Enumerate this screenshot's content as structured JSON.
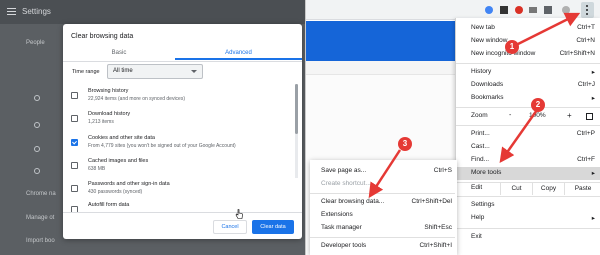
{
  "settings": {
    "title": "Settings",
    "sidebar": [
      "People",
      "Chrome na",
      "Manage ot",
      "Import boo"
    ]
  },
  "dialog": {
    "title": "Clear browsing data",
    "tabs": {
      "basic": "Basic",
      "advanced": "Advanced"
    },
    "time_range_label": "Time range",
    "time_range_value": "All time",
    "items": [
      {
        "title": "Browsing history",
        "sub": "22,924 items (and more on synced devices)",
        "checked": false
      },
      {
        "title": "Download history",
        "sub": "1,213 items",
        "checked": false
      },
      {
        "title": "Cookies and other site data",
        "sub": "From 4,779 sites (you won't be signed out of your Google Account)",
        "checked": true
      },
      {
        "title": "Cached images and files",
        "sub": "638 MB",
        "checked": false
      },
      {
        "title": "Passwords and other sign-in data",
        "sub": "430 passwords (synced)",
        "checked": false
      },
      {
        "title": "Autofill form data",
        "sub": "",
        "checked": false
      }
    ],
    "cancel_label": "Cancel",
    "clear_label": "Clear data",
    "accent": "#1a73e8"
  },
  "menu": {
    "new_tab": {
      "label": "New tab",
      "shortcut": "Ctrl+T"
    },
    "new_window": {
      "label": "New window",
      "shortcut": "Ctrl+N"
    },
    "new_incognito": {
      "label": "New incognito window",
      "shortcut": "Ctrl+Shift+N"
    },
    "history": {
      "label": "History",
      "shortcut": ""
    },
    "downloads": {
      "label": "Downloads",
      "shortcut": "Ctrl+J"
    },
    "bookmarks": {
      "label": "Bookmarks",
      "shortcut": ""
    },
    "zoom": {
      "label": "Zoom",
      "minus": "-",
      "value": "100%",
      "plus": "+"
    },
    "print": {
      "label": "Print...",
      "shortcut": "Ctrl+P"
    },
    "cast": {
      "label": "Cast...",
      "shortcut": ""
    },
    "find": {
      "label": "Find...",
      "shortcut": "Ctrl+F"
    },
    "more_tools": {
      "label": "More tools",
      "shortcut": ""
    },
    "edit": {
      "label": "Edit",
      "cut": "Cut",
      "copy": "Copy",
      "paste": "Paste"
    },
    "settings": {
      "label": "Settings",
      "shortcut": ""
    },
    "help": {
      "label": "Help",
      "shortcut": ""
    },
    "exit": {
      "label": "Exit",
      "shortcut": ""
    }
  },
  "submenu": {
    "save_page": {
      "label": "Save page as...",
      "shortcut": "Ctrl+S"
    },
    "create_shortcut": {
      "label": "Create shortcut...",
      "shortcut": ""
    },
    "clear_browsing": {
      "label": "Clear browsing data...",
      "shortcut": "Ctrl+Shift+Del"
    },
    "extensions": {
      "label": "Extensions",
      "shortcut": ""
    },
    "task_manager": {
      "label": "Task manager",
      "shortcut": "Shift+Esc"
    },
    "developer_tools": {
      "label": "Developer tools",
      "shortcut": "Ctrl+Shift+I"
    }
  },
  "badges": {
    "one": "1",
    "two": "2",
    "three": "3"
  },
  "colors": {
    "annotation": "#e53935",
    "browser_blue": "#1565d8"
  }
}
